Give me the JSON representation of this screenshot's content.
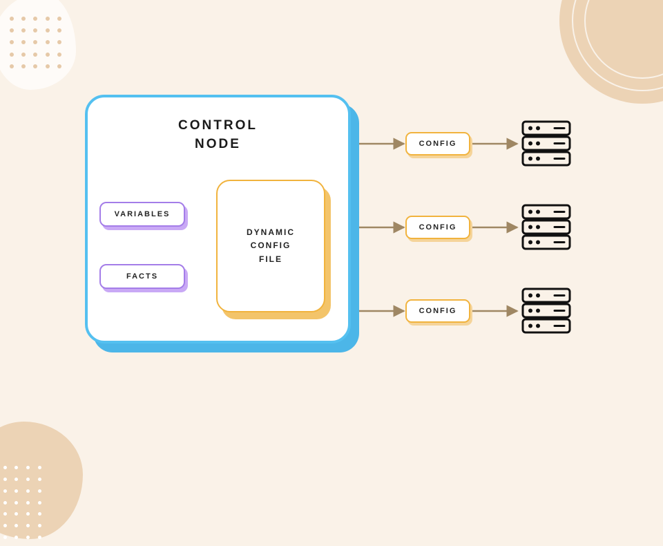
{
  "diagram": {
    "control_node": {
      "title_line1": "CONTROL",
      "title_line2": "NODE",
      "inputs": {
        "variables_label": "VARIABLES",
        "facts_label": "FACTS"
      },
      "dynamic_config": {
        "line1": "DYNAMIC",
        "line2": "CONFIG",
        "line3": "FILE"
      }
    },
    "outputs": [
      {
        "label": "CONFIG",
        "target": "server-1"
      },
      {
        "label": "CONFIG",
        "target": "server-2"
      },
      {
        "label": "CONFIG",
        "target": "server-3"
      }
    ]
  },
  "colors": {
    "background": "#faf2e8",
    "control_border": "#54c0f0",
    "control_shadow": "#4cb6e8",
    "pill_border": "#a47de8",
    "pill_shadow": "#c9a9f5",
    "dcf_border": "#f1b33d",
    "dcf_shadow": "#f3c46a",
    "config_border": "#f1b33d",
    "config_shadow": "#f5d499",
    "connector": "#9f8763",
    "deco_dot": "#e6c9a8",
    "deco_blob": "#ecd3b5"
  }
}
